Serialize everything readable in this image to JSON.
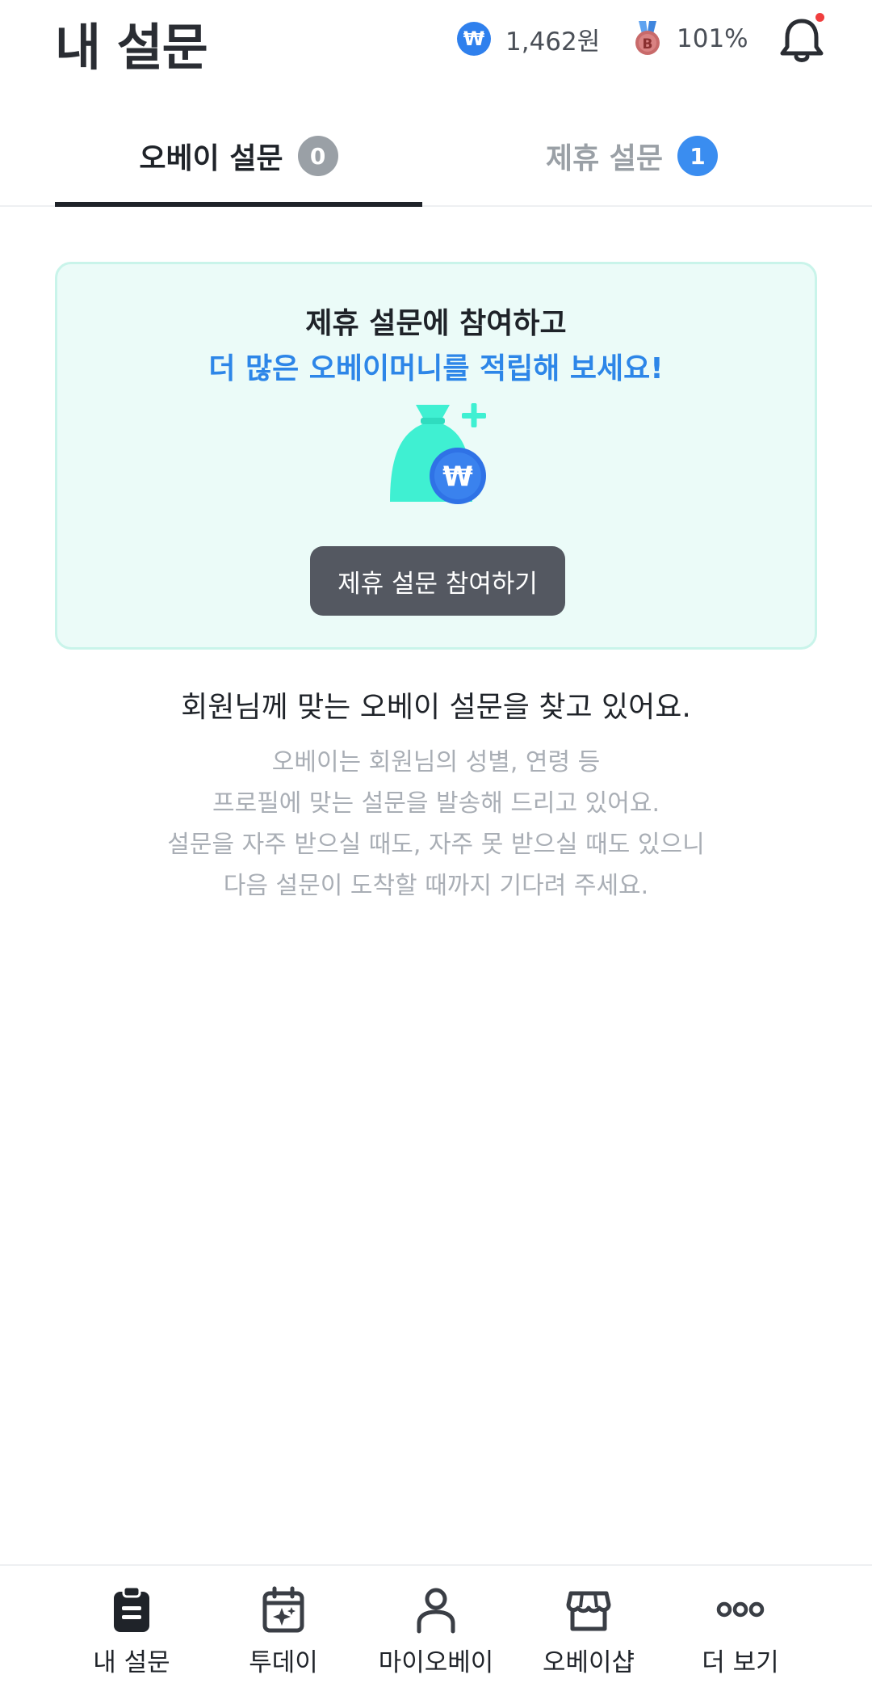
{
  "header": {
    "title": "내 설문",
    "money_icon_symbol": "₩",
    "money": "1,462원",
    "medal_letter": "B",
    "rate": "101%",
    "icons": {
      "money": "won-coin-icon",
      "medal": "medal-icon",
      "notification": "bell-icon"
    }
  },
  "tabs": [
    {
      "label": "오베이 설문",
      "count": "0",
      "active": true
    },
    {
      "label": "제휴 설문",
      "count": "1",
      "active": false
    }
  ],
  "promo": {
    "line1": "제휴 설문에 참여하고",
    "line2": "더 많은 오베이머니를 적립해 보세요!",
    "bag_symbol": "₩",
    "button": "제휴 설문 참여하기"
  },
  "info": {
    "title": "회원님께 맞는 오베이 설문을 찾고 있어요.",
    "lines": [
      "오베이는 회원님의 성별, 연령 등",
      "프로필에 맞는 설문을 발송해 드리고 있어요.",
      "설문을 자주 받으실 때도, 자주 못 받으실 때도 있으니",
      "다음 설문이 도착할 때까지 기다려 주세요."
    ]
  },
  "nav": [
    {
      "label": "내 설문",
      "icon": "clipboard-icon"
    },
    {
      "label": "투데이",
      "icon": "calendar-sparkle-icon"
    },
    {
      "label": "마이오베이",
      "icon": "person-icon"
    },
    {
      "label": "오베이샵",
      "icon": "shop-icon"
    },
    {
      "label": "더 보기",
      "icon": "more-icon"
    }
  ],
  "colors": {
    "accent_blue": "#2d86e8",
    "promo_bg": "#ebfbf8",
    "bag_mint": "#3ff0d2",
    "button_dark": "#545861",
    "notification_dot": "#f03e3e"
  }
}
